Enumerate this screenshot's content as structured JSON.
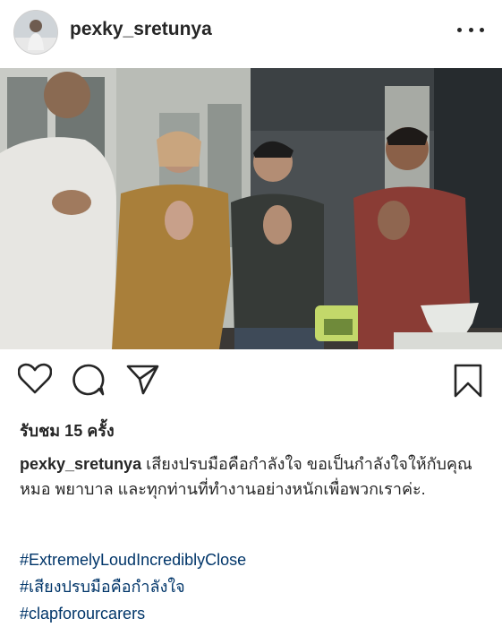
{
  "header": {
    "username": "pexky_sretunya"
  },
  "icons": {
    "more": "more-horizontal-icon",
    "like": "heart-icon",
    "comment": "comment-icon",
    "share": "send-icon",
    "save": "bookmark-icon"
  },
  "post": {
    "views": "รับชม 15 ครั้ง",
    "caption_user": "pexky_sretunya",
    "caption_text": "เสียงปรบมือคือกำลังใจ ขอเป็นกำลังใจให้กับคุณหมอ พยาบาล และทุกท่านที่ทำงานอย่างหนักเพื่อพวกเราค่ะ.",
    "hashtags": [
      "#ExtremelyLoudIncrediblyClose",
      "#เสียงปรบมือคือกำลังใจ",
      "#clapforourcarers"
    ]
  },
  "colors": {
    "text": "#262626",
    "hashtag": "#003569"
  }
}
